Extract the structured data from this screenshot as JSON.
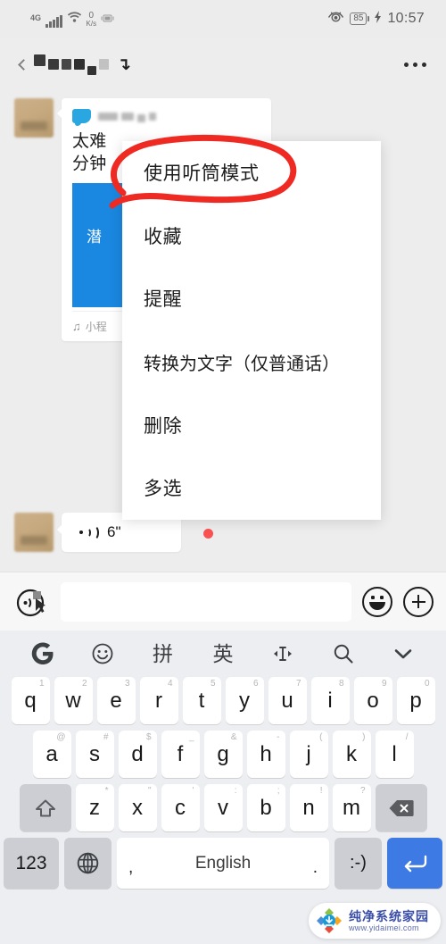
{
  "status_bar": {
    "network_type": "4G",
    "data_rate_value": "0",
    "data_rate_unit": "K/s",
    "battery_level": "85",
    "time": "10:57",
    "icons": [
      "signal-bars-icon",
      "wifi-icon",
      "vibrate-icon",
      "eye-care-icon",
      "battery-icon",
      "charging-bolt-icon"
    ]
  },
  "chat_header": {
    "title_censored": true,
    "more_label": "···"
  },
  "messages": {
    "card": {
      "app_name_censored": true,
      "title_line1": "太难",
      "title_line2": "分钟",
      "image_caption": "潜",
      "footer_label": "小程",
      "footer_icon": "miniprogram-icon"
    },
    "voice": {
      "duration": "6\"",
      "icon": "voice-wave-icon",
      "unread": true
    }
  },
  "context_menu": {
    "items": [
      {
        "label": "使用听筒模式",
        "highlighted": true
      },
      {
        "label": "收藏",
        "highlighted": false
      },
      {
        "label": "提醒",
        "highlighted": false
      },
      {
        "label": "转换为文字（仅普通话）",
        "highlighted": false
      },
      {
        "label": "删除",
        "highlighted": false
      },
      {
        "label": "多选",
        "highlighted": false
      }
    ],
    "annotation_color": "#ee2a22"
  },
  "input_bar": {
    "voice_icon": "voice-input-icon",
    "text_value": "",
    "text_placeholder": "",
    "emoji_icon": "emoji-icon",
    "plus_icon": "plus-icon"
  },
  "keyboard": {
    "toolbar": [
      {
        "label": "G",
        "name": "google-logo-icon"
      },
      {
        "label": "☺",
        "name": "emoji-icon"
      },
      {
        "label": "拼",
        "name": "pinyin-mode-button"
      },
      {
        "label": "英",
        "name": "english-mode-button"
      },
      {
        "label": "❮I❯",
        "name": "cursor-move-icon"
      },
      {
        "label": "🔍",
        "name": "search-icon"
      },
      {
        "label": "⌄",
        "name": "chevron-down-icon"
      }
    ],
    "row1": [
      {
        "key": "q",
        "sup": "1"
      },
      {
        "key": "w",
        "sup": "2"
      },
      {
        "key": "e",
        "sup": "3"
      },
      {
        "key": "r",
        "sup": "4"
      },
      {
        "key": "t",
        "sup": "5"
      },
      {
        "key": "y",
        "sup": "6"
      },
      {
        "key": "u",
        "sup": "7"
      },
      {
        "key": "i",
        "sup": "8"
      },
      {
        "key": "o",
        "sup": "9"
      },
      {
        "key": "p",
        "sup": "0"
      }
    ],
    "row2": [
      {
        "key": "a",
        "sup": "@"
      },
      {
        "key": "s",
        "sup": "#"
      },
      {
        "key": "d",
        "sup": "$"
      },
      {
        "key": "f",
        "sup": "_"
      },
      {
        "key": "g",
        "sup": "&"
      },
      {
        "key": "h",
        "sup": "-"
      },
      {
        "key": "j",
        "sup": "("
      },
      {
        "key": "k",
        "sup": ")"
      },
      {
        "key": "l",
        "sup": "/"
      }
    ],
    "row3": [
      {
        "key": "z",
        "sup": "*"
      },
      {
        "key": "x",
        "sup": "\""
      },
      {
        "key": "c",
        "sup": "'"
      },
      {
        "key": "v",
        "sup": ":"
      },
      {
        "key": "b",
        "sup": ";"
      },
      {
        "key": "n",
        "sup": "!"
      },
      {
        "key": "m",
        "sup": "?"
      }
    ],
    "shift_label": "⇧",
    "backspace_label": "⌫",
    "num_label": "123",
    "globe_label": "🌐",
    "space_label": "English",
    "space_comma": ",",
    "space_period": ".",
    "smiley_label": ":-)",
    "enter_label": "↵",
    "enter_color": "#3e7ae4"
  },
  "watermark": {
    "title": "纯净系统家园",
    "url": "www.yidaimei.com"
  }
}
